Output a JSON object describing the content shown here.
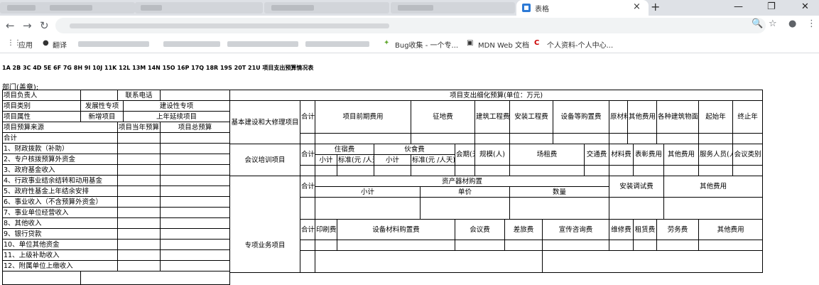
{
  "browser": {
    "active_tab_title": "表格",
    "new_tab": "+",
    "window_controls": [
      "—",
      "❐",
      "✕"
    ],
    "nav": {
      "back": "←",
      "forward": "→",
      "reload": "↻"
    },
    "omnibox_icons": {
      "zoom": "🔍",
      "star": "☆",
      "account": "●",
      "menu": "⋮"
    },
    "bookmarks": {
      "apps": "应用",
      "translate": "翻译",
      "bug": "Bug收集 - 一个专...",
      "mdn": "MDN Web 文档",
      "profile": "个人资料-个人中心..."
    }
  },
  "page": {
    "title": "1A 2B 3C 4D 5E 6F 7G 8H 9I 10J 11K 12L 13M 14N 15O 16P 17Q 18R 19S 20T 21U 项目支出预算情况表",
    "dept_label": "部门(盖章):"
  },
  "left_table": {
    "r1": {
      "a": "项目负责人",
      "b": "联系电话"
    },
    "r2": {
      "a": "项目类别",
      "b": "发展性专项",
      "c": "建设性专项"
    },
    "r3": {
      "a": "项目属性",
      "b": "新增项目",
      "c": "上年延续项目"
    },
    "r4": {
      "a": "项目预算来源",
      "b": "项目当年预算",
      "c": "项目总预算"
    },
    "sources": [
      "合计",
      "1、财政拨款（补助）",
      "2、专户核拨预算外资金",
      "3、政府基金收入",
      "4、行政事业结余结转和动用基金",
      "5、政府性基金上年结余安排",
      "6、事业收入（不含预算外资金）",
      "7、事业单位经营收入",
      "8、其他收入",
      "9、银行贷款",
      "10、单位其他资金",
      "11、上级补助收入",
      "12、附属单位上缴收入"
    ]
  },
  "right_table": {
    "header": "项目支出细化预算(单位：万元)",
    "construction": {
      "label": "基本建设和大修理项目",
      "cols": [
        "合计",
        "项目前期费用",
        "征地费",
        "建筑工程费",
        "安装工程费",
        "设备等购置费",
        "原材料",
        "其他费用",
        "各种建筑物面积",
        "起始年",
        "终止年"
      ]
    },
    "training": {
      "label": "会议培训项目",
      "total": "合计",
      "lodging": "住宿费",
      "food": "伙食费",
      "subtotal": "小计",
      "standard": "标准(元 /人天)",
      "days": "会期(天)",
      "scale": "规模(人)",
      "venue": "场租费",
      "traffic": "交通费",
      "materials": "材料费",
      "reward": "表彰费用",
      "other": "其他费用",
      "staff": "服务人员(人)",
      "meeting_type": "会议类别"
    },
    "assets": {
      "total": "合计",
      "purchase": "资产器材购置",
      "subtotal": "小计",
      "unit_price": "单价",
      "quantity": "数量",
      "install": "安装调试费",
      "other": "其他费用"
    },
    "special": {
      "label": "专项业务项目",
      "cols": [
        "合计",
        "印刷费",
        "设备材料购置费",
        "会议费",
        "差旅费",
        "宣传咨询费",
        "维修费",
        "租赁费",
        "劳务费",
        "其他费用"
      ]
    }
  }
}
